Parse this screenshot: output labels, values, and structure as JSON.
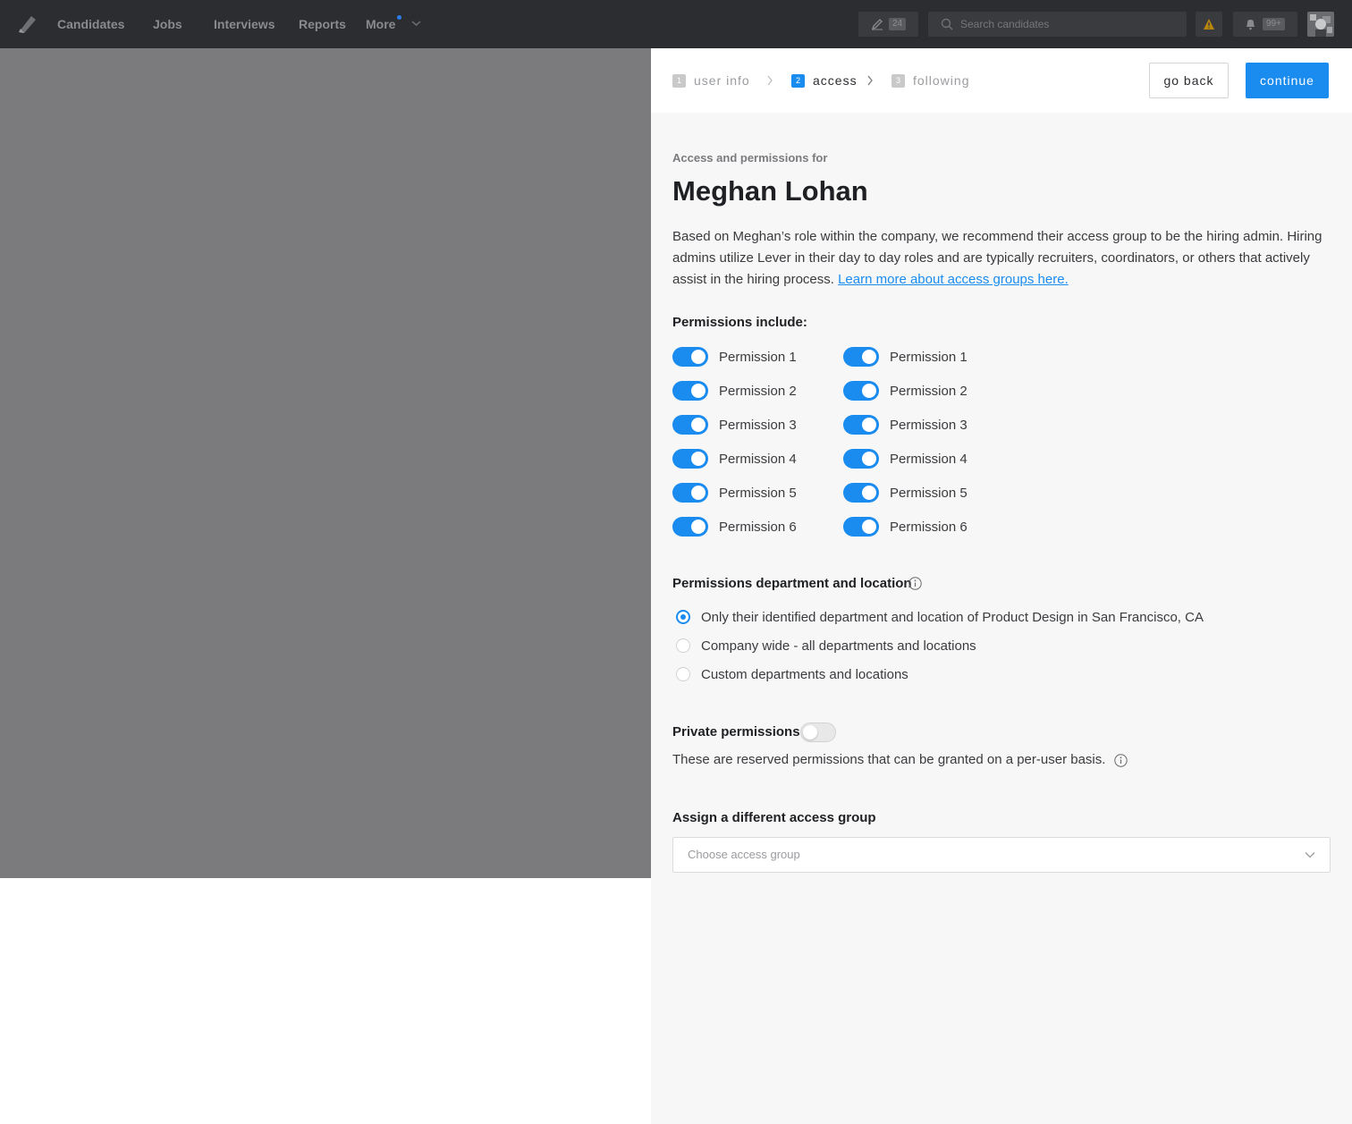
{
  "nav": {
    "items": [
      "Candidates",
      "Jobs",
      "Interviews",
      "Reports",
      "More"
    ],
    "compose_count": "24",
    "search_placeholder": "Search candidates",
    "notifications_count": "99+"
  },
  "panel": {
    "steps": [
      {
        "num": "1",
        "label": "user info",
        "state": "inactive"
      },
      {
        "num": "2",
        "label": "access",
        "state": "active"
      },
      {
        "num": "3",
        "label": "following",
        "state": "inactive"
      }
    ],
    "go_back_label": "go back",
    "continue_label": "continue",
    "eyebrow": "Access and permissions for",
    "user_name": "Meghan Lohan",
    "description": "Based on Meghan’s role within the company, we recommend their access group to be the hiring admin. Hiring admins utilize Lever in their day to day roles and are typically recruiters, coordinators, or others that actively assist in the hiring process.",
    "learn_more_link": "Learn more about access groups here.",
    "permissions_heading": "Permissions include:",
    "permissions_left": [
      {
        "label": "Permission 1",
        "enabled": true
      },
      {
        "label": "Permission 2",
        "enabled": true
      },
      {
        "label": "Permission 3",
        "enabled": true
      },
      {
        "label": "Permission 4",
        "enabled": true
      },
      {
        "label": "Permission 5",
        "enabled": true
      },
      {
        "label": "Permission 6",
        "enabled": true
      }
    ],
    "permissions_right": [
      {
        "label": "Permission 1",
        "enabled": true
      },
      {
        "label": "Permission 2",
        "enabled": true
      },
      {
        "label": "Permission 3",
        "enabled": true
      },
      {
        "label": "Permission 4",
        "enabled": true
      },
      {
        "label": "Permission 5",
        "enabled": true
      },
      {
        "label": "Permission 6",
        "enabled": true
      }
    ],
    "dept_heading": "Permissions department and location",
    "dept_options": [
      {
        "label": "Only their identified department and location of Product Design in San Francisco, CA",
        "checked": true
      },
      {
        "label": "Company wide - all departments and locations",
        "checked": false
      },
      {
        "label": "Custom departments and locations",
        "checked": false
      }
    ],
    "private_heading": "Private permissions",
    "private_enabled": false,
    "private_note": "These are reserved permissions that can be granted on a per-user basis.",
    "assign_heading": "Assign a different access group",
    "assign_placeholder": "Choose access group"
  },
  "colors": {
    "accent": "#1a8cf0",
    "nav_bg": "#2c2d30",
    "overlay": "#7b7b7d",
    "panel_bg": "#f7f7f7",
    "warning": "#b8860b"
  }
}
